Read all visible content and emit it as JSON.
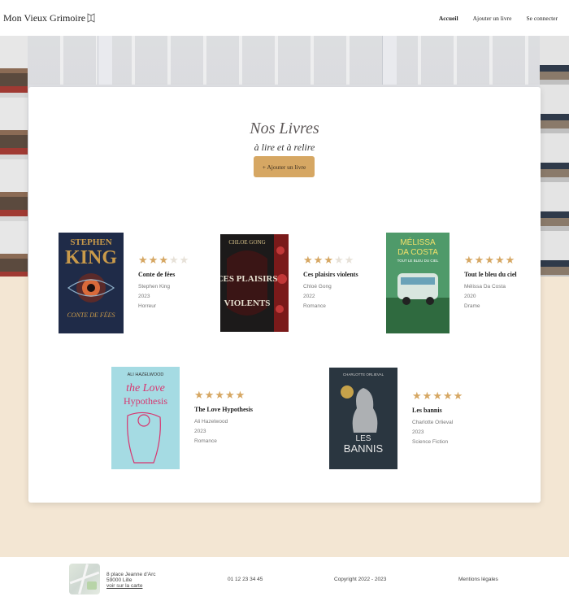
{
  "header": {
    "brand": "Mon Vieux Grimoire",
    "nav": [
      {
        "label": "Accueil",
        "active": true
      },
      {
        "label": "Ajouter un livre",
        "active": false
      },
      {
        "label": "Se connecter",
        "active": false
      }
    ]
  },
  "main": {
    "title": "Nos Livres",
    "subtitle": "à lire et à relire",
    "add_button": "+ Ajouter un livre"
  },
  "books": [
    {
      "title": "Conte de fées",
      "author": "Stephen King",
      "year": "2023",
      "genre": "Horreur",
      "rating": 3,
      "cover": {
        "line1": "STEPHEN",
        "line2": "KING",
        "line3": "CONTE DE FÉES",
        "bg": "#1f2b48",
        "accent": "#c99a4a"
      }
    },
    {
      "title": "Ces plaisirs violents",
      "author": "Chloé Gong",
      "year": "2022",
      "genre": "Romance",
      "rating": 3,
      "cover": {
        "line1": "CHLOE GONG",
        "line2": "CES PLAISIRS",
        "line3": "VIOLENTS",
        "bg": "#1c1a1a",
        "accent": "#b32a2a"
      }
    },
    {
      "title": "Tout le bleu du ciel",
      "author": "Mélissa Da Costa",
      "year": "2020",
      "genre": "Drame",
      "rating": 5,
      "cover": {
        "line1": "MÉLISSA",
        "line2": "DA COSTA",
        "line3": "TOUT LE BLEU DU CIEL",
        "bg": "#3f8a5a",
        "accent": "#e5d44a"
      }
    },
    {
      "title": "The Love Hypothesis",
      "author": "Ali Hazelwood",
      "year": "2023",
      "genre": "Romance",
      "rating": 5,
      "cover": {
        "line1": "ALI HAZELWOOD",
        "line2": "the Love",
        "line3": "Hypothesis",
        "bg": "#9ed6df",
        "accent": "#d8356f"
      }
    },
    {
      "title": "Les bannis",
      "author": "Charlotte Orlieval",
      "year": "2023",
      "genre": "Science Fiction",
      "rating": 5,
      "cover": {
        "line1": "CHARLOTTE ORLIEVAL",
        "line2": "LES",
        "line3": "BANNIS",
        "bg": "#26313a",
        "accent": "#d7d7d7"
      }
    }
  ],
  "footer": {
    "address_line1": "8 place Jeanne d'Arc",
    "address_line2": "59000 Lille",
    "map_link": "voir sur la carte",
    "phone": "01 12 23 34 45",
    "copyright": "Copyright 2022 - 2023",
    "legal": "Mentions légales"
  },
  "colors": {
    "accent": "#d6a763",
    "page_bg": "#f3e6d3",
    "star_off": "#e7e1d8"
  },
  "icons": {
    "brand": "open-book-icon",
    "star": "star-icon",
    "map": "map-thumbnail"
  }
}
